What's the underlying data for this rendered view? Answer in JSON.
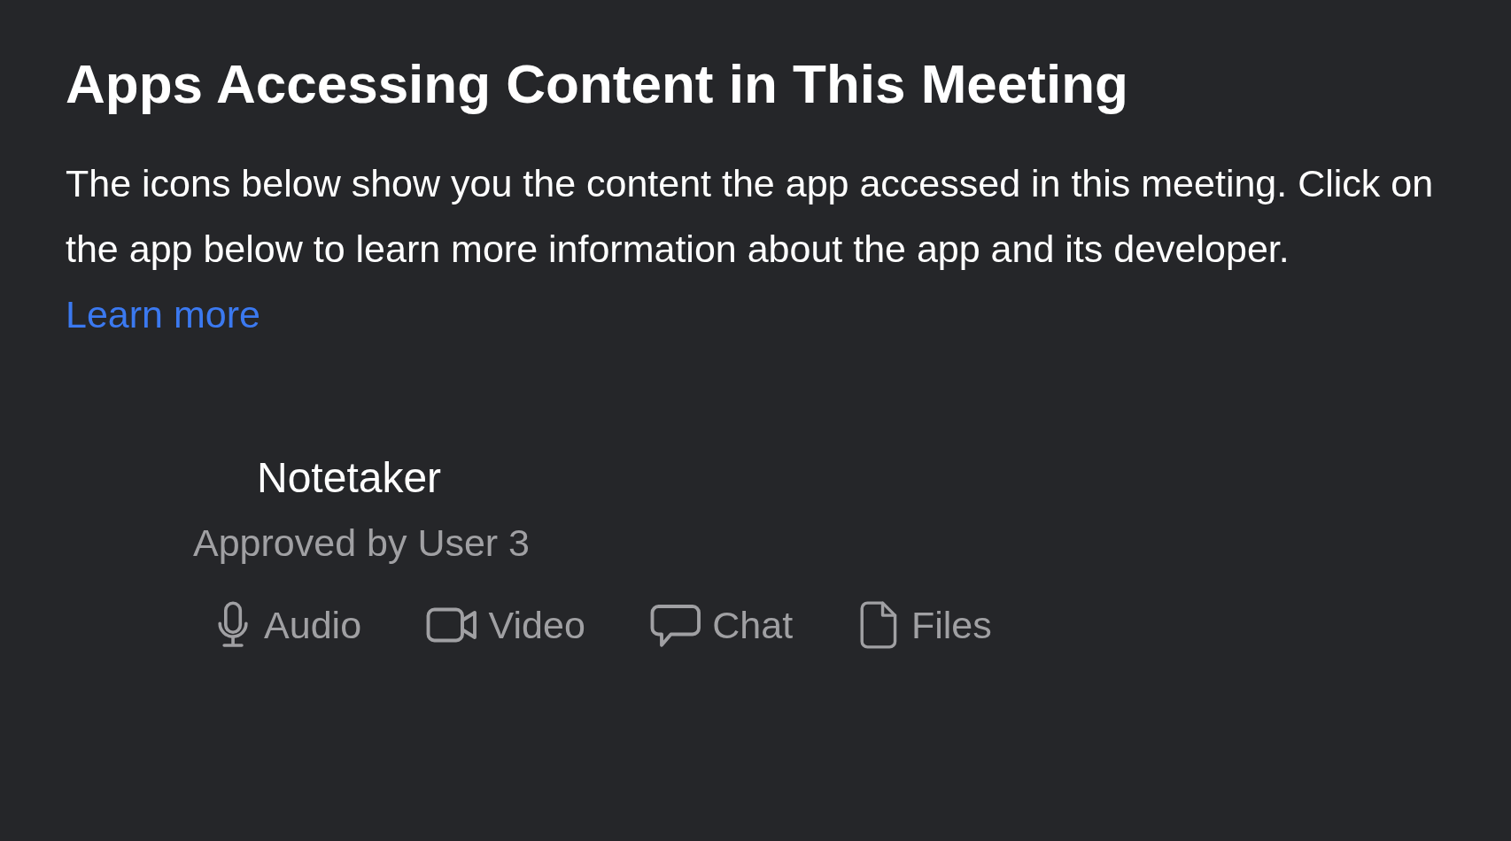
{
  "title": "Apps Accessing Content in This Meeting",
  "description": "The icons below show you the content the app accessed in this meeting. Click on the app below to learn more information about the app and its developer.",
  "learn_more_link": "Learn more",
  "app": {
    "name": "Notetaker",
    "approved_by": "Approved by User 3",
    "access": [
      {
        "kind": "audio",
        "label": "Audio"
      },
      {
        "kind": "video",
        "label": "Video"
      },
      {
        "kind": "chat",
        "label": "Chat"
      },
      {
        "kind": "files",
        "label": "Files"
      }
    ]
  }
}
